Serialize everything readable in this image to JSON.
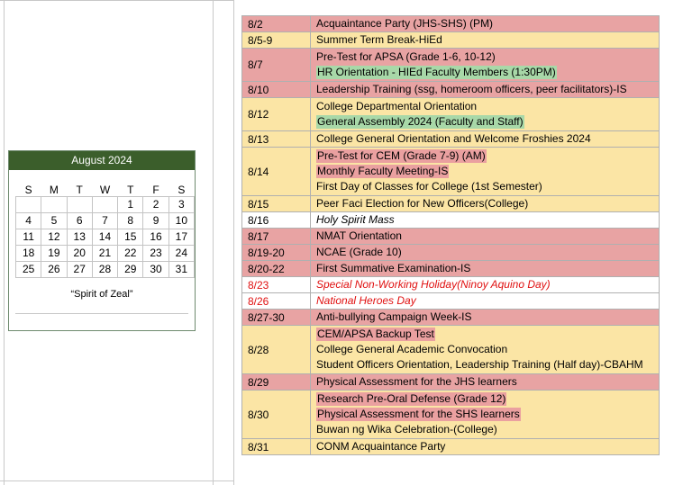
{
  "calendar": {
    "title": "August 2024",
    "weekdays": [
      "S",
      "M",
      "T",
      "W",
      "T",
      "F",
      "S"
    ],
    "weeks": [
      [
        "",
        "",
        "",
        "",
        "1",
        "2",
        "3"
      ],
      [
        "4",
        "5",
        "6",
        "7",
        "8",
        "9",
        "10"
      ],
      [
        "11",
        "12",
        "13",
        "14",
        "15",
        "16",
        "17"
      ],
      [
        "18",
        "19",
        "20",
        "21",
        "22",
        "23",
        "24"
      ],
      [
        "25",
        "26",
        "27",
        "28",
        "29",
        "30",
        "31"
      ]
    ],
    "motto": "“Spirit of Zeal”"
  },
  "colors": {
    "pink": "#e8a3a3",
    "yellow": "#fbe5a5",
    "white": "#ffffff",
    "header_green": "#3b5e2b"
  },
  "events": [
    {
      "date": "8/2",
      "bg": "#e8a3a3",
      "lines": [
        {
          "text": "Acquaintance Party (JHS-SHS) (PM)"
        }
      ]
    },
    {
      "date": "8/5-9",
      "bg": "#fbe5a5",
      "lines": [
        {
          "text": "Summer Term Break-HiEd"
        }
      ]
    },
    {
      "date": "8/7",
      "bg": "#e8a3a3",
      "lines": [
        {
          "text": "Pre-Test for APSA (Grade 1-6, 10-12)"
        },
        {
          "text": "HR Orientation - HIEd Faculty Members (1:30PM)",
          "hl": "green"
        }
      ]
    },
    {
      "date": "8/10",
      "bg": "#e8a3a3",
      "lines": [
        {
          "text": "Leadership Training (ssg, homeroom officers, peer facilitators)-IS"
        }
      ]
    },
    {
      "date": "8/12",
      "bg": "#fbe5a5",
      "lines": [
        {
          "text": "College Departmental Orientation"
        },
        {
          "text": "General Assembly 2024 (Faculty and Staff)",
          "hl": "green"
        }
      ]
    },
    {
      "date": "8/13",
      "bg": "#fbe5a5",
      "lines": [
        {
          "text": "College General Orientation and Welcome Froshies 2024"
        }
      ]
    },
    {
      "date": "8/14",
      "bg": "#fbe5a5",
      "lines": [
        {
          "text": "Pre-Test for CEM (Grade 7-9) (AM)",
          "hl": "pink"
        },
        {
          "text": "Monthly Faculty Meeting-IS",
          "hl": "pink"
        },
        {
          "text": "First Day of Classes for College (1st Semester)"
        }
      ]
    },
    {
      "date": "8/15",
      "bg": "#fbe5a5",
      "lines": [
        {
          "text": "Peer Faci Election for New Officers(College)"
        }
      ]
    },
    {
      "date": "8/16",
      "bg": "#ffffff",
      "lines": [
        {
          "text": "Holy Spirit Mass",
          "style": "italic"
        }
      ]
    },
    {
      "date": "8/17",
      "bg": "#e8a3a3",
      "lines": [
        {
          "text": "NMAT Orientation"
        }
      ]
    },
    {
      "date": "8/19-20",
      "bg": "#e8a3a3",
      "lines": [
        {
          "text": "NCAE (Grade 10)"
        }
      ]
    },
    {
      "date": "8/20-22",
      "bg": "#e8a3a3",
      "lines": [
        {
          "text": "First Summative Examination-IS"
        }
      ]
    },
    {
      "date": "8/23",
      "bg": "#ffffff",
      "red": true,
      "lines": [
        {
          "text": "Special Non-Working Holiday(Ninoy Aquino Day)",
          "style": "italic"
        }
      ]
    },
    {
      "date": "8/26",
      "bg": "#ffffff",
      "red": true,
      "lines": [
        {
          "text": "National Heroes Day",
          "style": "italic"
        }
      ]
    },
    {
      "date": "8/27-30",
      "bg": "#e8a3a3",
      "lines": [
        {
          "text": "Anti-bullying Campaign Week-IS"
        }
      ]
    },
    {
      "date": "8/28",
      "bg": "#fbe5a5",
      "lines": [
        {
          "text": "CEM/APSA Backup Test",
          "hl": "pink"
        },
        {
          "text": "College General Academic Convocation"
        },
        {
          "text": "Student Officers Orientation, Leadership Training (Half day)-CBAHM"
        }
      ]
    },
    {
      "date": "8/29",
      "bg": "#e8a3a3",
      "lines": [
        {
          "text": "Physical Assessment for the JHS learners"
        }
      ]
    },
    {
      "date": "8/30",
      "bg": "#fbe5a5",
      "lines": [
        {
          "text": "Research Pre-Oral Defense (Grade 12)",
          "hl": "pink"
        },
        {
          "text": "Physical Assessment for the SHS learners",
          "hl": "pink"
        },
        {
          "text": "Buwan ng Wika Celebration-(College)"
        }
      ]
    },
    {
      "date": "8/31",
      "bg": "#fbe5a5",
      "lines": [
        {
          "text": "CONM Acquaintance Party"
        }
      ]
    }
  ]
}
